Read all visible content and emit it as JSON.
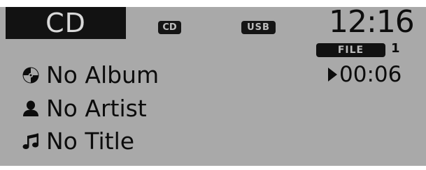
{
  "source_tabs": {
    "active_label": "CD",
    "cd_badge": "CD",
    "usb_badge": "USB"
  },
  "clock": "12:16",
  "file": {
    "label": "FILE",
    "number": "1"
  },
  "elapsed": "00:06",
  "track_info": {
    "album": "No Album",
    "artist": "No Artist",
    "title": "No Title"
  },
  "icons": {
    "album": "disc-icon",
    "artist": "person-icon",
    "title": "music-note-icon",
    "play": "play-icon"
  },
  "colors": {
    "screen_bg": "#a9a9a9",
    "active_tab_bg": "#121212",
    "text": "#0c0c0c"
  }
}
